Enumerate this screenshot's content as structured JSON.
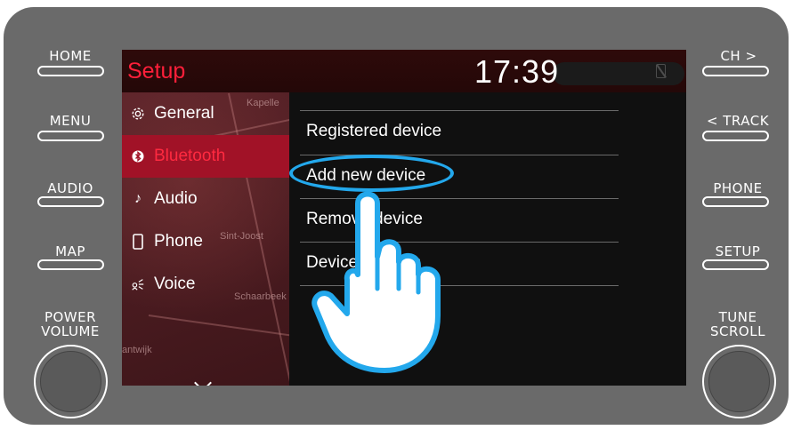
{
  "hardware": {
    "left": [
      "HOME",
      "MENU",
      "AUDIO",
      "MAP"
    ],
    "right": [
      "CH >",
      "< TRACK",
      "PHONE",
      "SETUP"
    ],
    "power_line1": "POWER",
    "power_line2": "VOLUME",
    "tune_line1": "TUNE",
    "tune_line2": "SCROLL"
  },
  "screen": {
    "title": "Setup",
    "clock": "17:39",
    "sidebar": [
      {
        "label": "General",
        "icon": "gear-icon",
        "selected": false
      },
      {
        "label": "Bluetooth",
        "icon": "bluetooth-icon",
        "selected": true
      },
      {
        "label": "Audio",
        "icon": "music-note-icon",
        "selected": false
      },
      {
        "label": "Phone",
        "icon": "phone-icon",
        "selected": false
      },
      {
        "label": "Voice",
        "icon": "voice-icon",
        "selected": false
      }
    ],
    "map_labels": [
      "Schaarbeek",
      "Kapelle",
      "Sint-Joost",
      "antwijk"
    ],
    "list": [
      {
        "label": "Registered device"
      },
      {
        "label": "Add new device"
      },
      {
        "label": "Remove device"
      },
      {
        "label": "Device settings"
      }
    ]
  },
  "colors": {
    "accent": "#ff1f3a",
    "selected_bg": "#a11227",
    "highlight": "#23a8ec",
    "bezel": "#6a6a6a"
  }
}
